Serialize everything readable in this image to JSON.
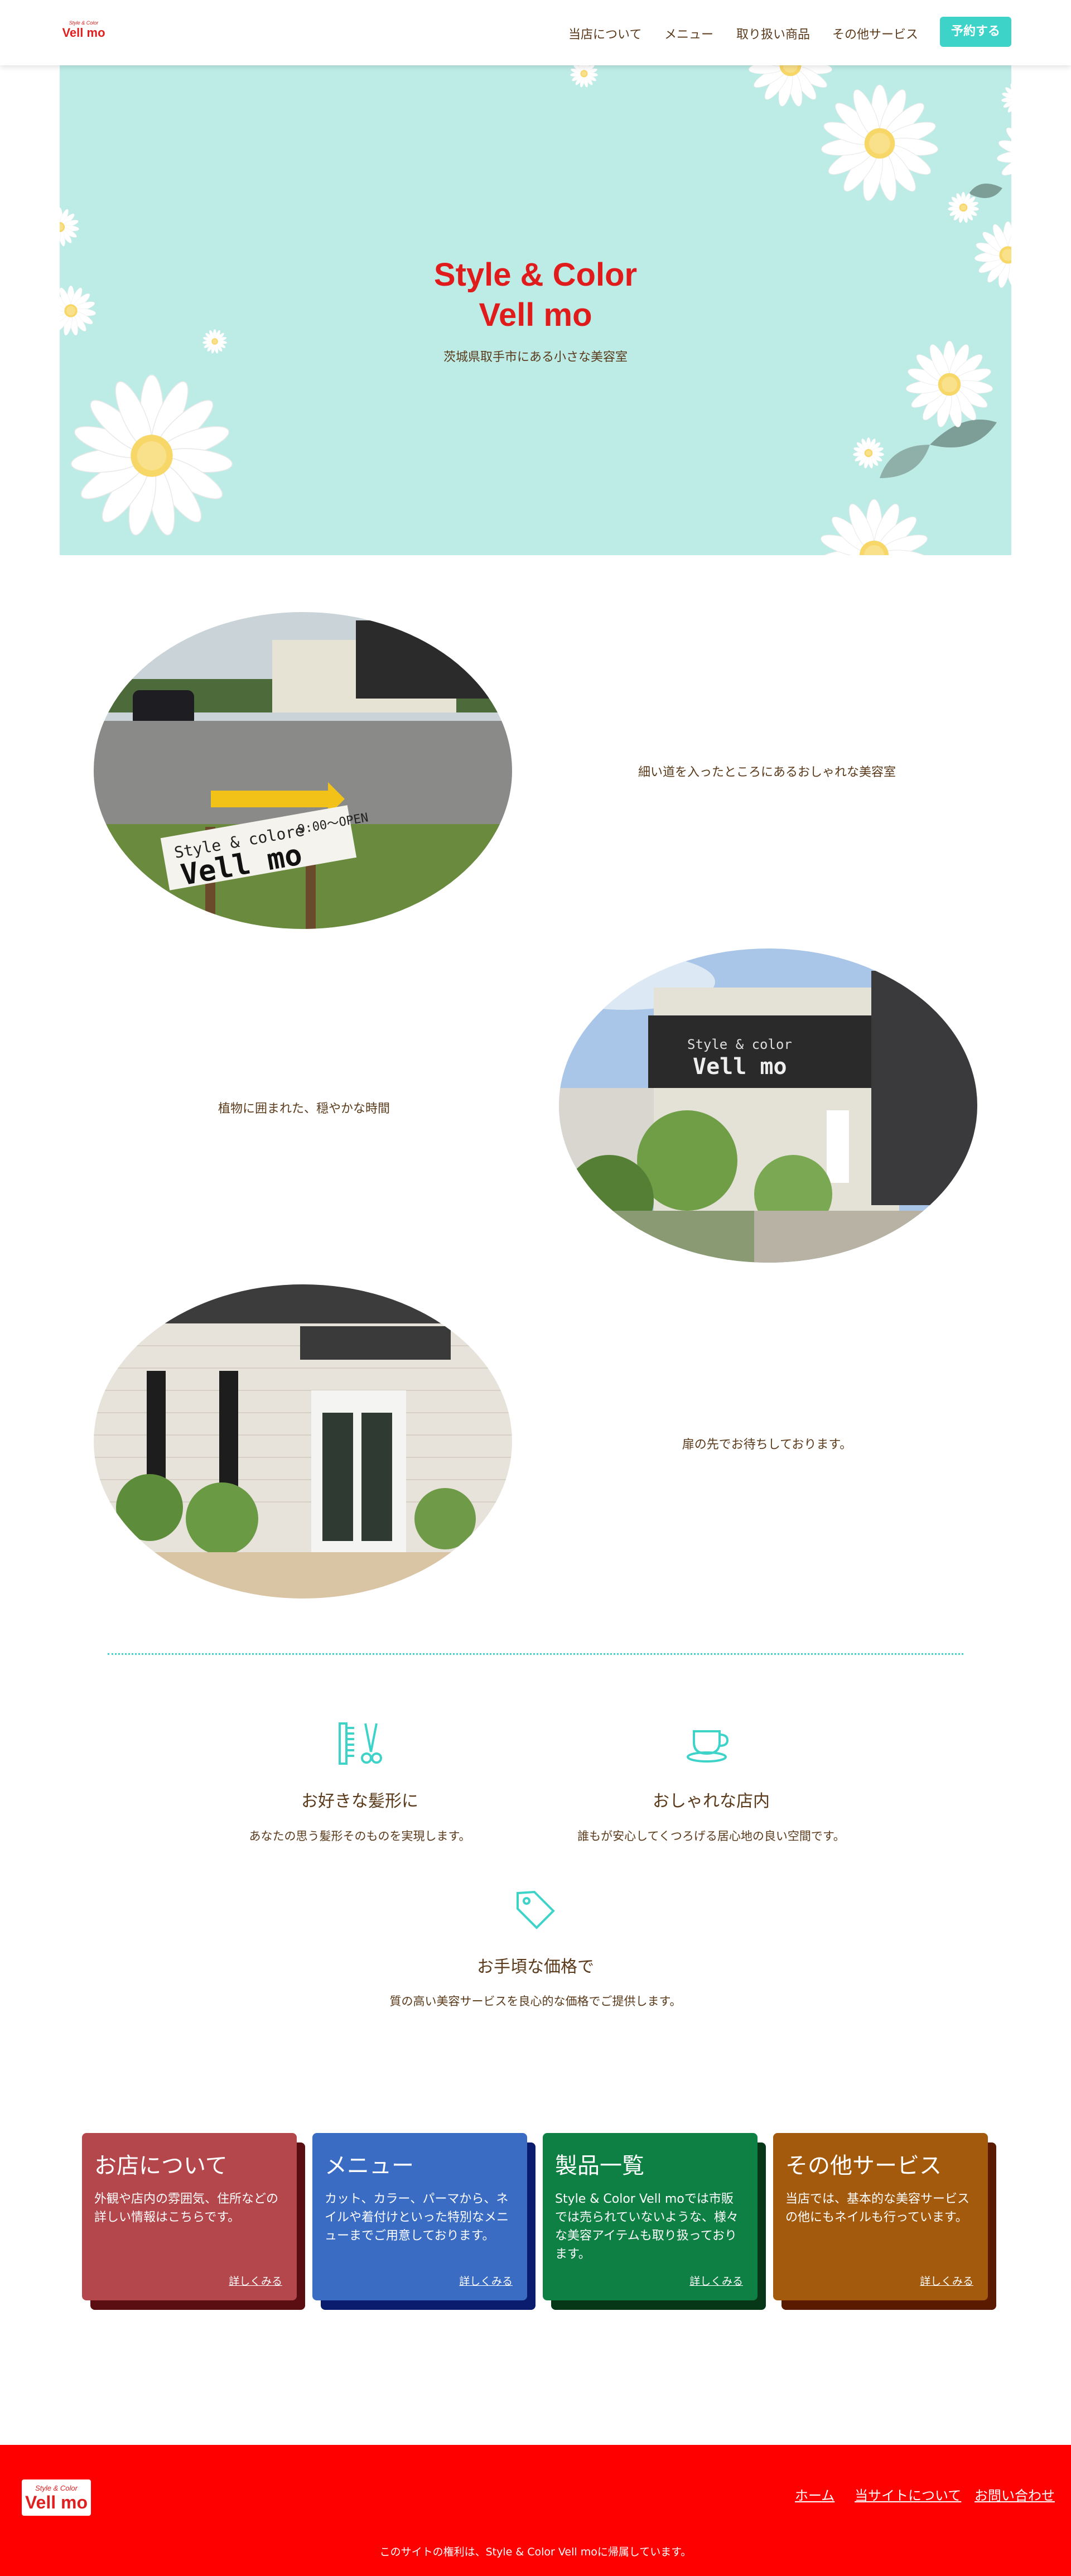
{
  "header": {
    "logo_small": "Style & Color",
    "logo_big": "Vell mo",
    "nav": [
      "当店について",
      "メニュー",
      "取り扱い商品",
      "その他サービス"
    ],
    "reserve_label": "予約する"
  },
  "hero": {
    "title_line1": "Style & Color",
    "title_line2": "Vell mo",
    "subtitle": "茨城県取手市にある小さな美容室"
  },
  "rows": [
    {
      "caption": "細い道を入ったところにあるおしゃれな美容室",
      "sign_line1": "Style & colore",
      "sign_line2": "Vell mo",
      "sign_hours": "9:00〜OPEN"
    },
    {
      "caption": "植物に囲まれた、穏やかな時間",
      "sign_line1": "Style & color",
      "sign_line2": "Vell mo"
    },
    {
      "caption": "扉の先でお待ちしております。"
    }
  ],
  "features": [
    {
      "icon": "comb-scissors-icon",
      "title": "お好きな髪形に",
      "desc": "あなたの思う髪形そのものを実現します。"
    },
    {
      "icon": "coffee-cup-icon",
      "title": "おしゃれな店内",
      "desc": "誰もが安心してくつろげる居心地の良い空間です。"
    },
    {
      "icon": "price-tag-icon",
      "title": "お手頃な価格で",
      "desc": "質の高い美容サービスを良心的な価格でご提供します。"
    }
  ],
  "cards": [
    {
      "title": "お店について",
      "body": "外観や店内の雰囲気、住所などの詳しい情報はこちらです。",
      "more": "詳しくみる",
      "color": "#b3474b",
      "shadow": "#5a0e12"
    },
    {
      "title": "メニュー",
      "body": "カット、カラー、パーマから、ネイルや着付けといった特別なメニューまでご用意しております。",
      "more": "詳しくみる",
      "color": "#3a6cc4",
      "shadow": "#0a1c6e"
    },
    {
      "title": "製品一覧",
      "body": "Style & Color Vell moでは市販では売られていないような、様々な美容アイテムも取り扱っております。",
      "more": "詳しくみる",
      "color": "#0f8044",
      "shadow": "#063818"
    },
    {
      "title": "その他サービス",
      "body": "当店では、基本的な美容サービスの他にもネイルも行っています。",
      "more": "詳しくみる",
      "color": "#a35a0c",
      "shadow": "#5a1a00"
    }
  ],
  "footer": {
    "logo_small": "Style & Color",
    "logo_big": "Vell mo",
    "links": [
      "ホーム",
      "当サイトについて",
      "お問い合わせ"
    ],
    "copyright": "このサイトの権利は、Style & Color Vell moに帰属しています。"
  },
  "colors": {
    "accent": "#3ed3c9",
    "brand_red": "#ff0000",
    "hero_bg": "#bdece7",
    "text": "#5a3a1a"
  }
}
